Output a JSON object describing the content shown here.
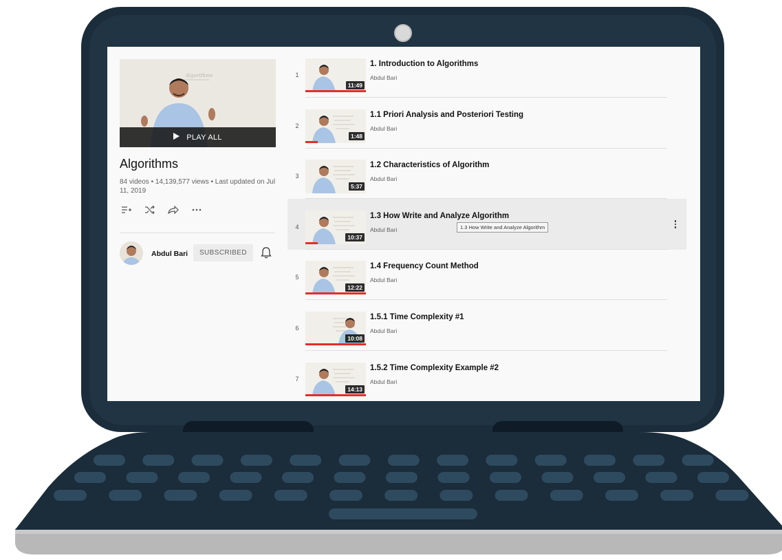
{
  "colors": {
    "laptop_body": "#1b2c3a",
    "key": "#2e4a5e",
    "base": "#bdbdbd",
    "accent": "#4fc3d6",
    "progress": "#e52d27",
    "hover_row": "#ebebeb"
  },
  "playlist": {
    "play_all_label": "PLAY ALL",
    "title": "Algorithms",
    "stats": "84 videos • 14,139,577 views • Last updated on Jul 11, 2019",
    "actions": [
      {
        "icon": "add-to-queue-icon",
        "glyph": "≡+"
      },
      {
        "icon": "shuffle-icon",
        "glyph": "⤮"
      },
      {
        "icon": "share-icon",
        "glyph": "⮫"
      },
      {
        "icon": "more-horizontal-icon",
        "glyph": "⋯"
      }
    ]
  },
  "channel": {
    "name": "Abdul Bari",
    "subscribe_label": "SUBSCRIBED"
  },
  "videos": [
    {
      "index": "1",
      "title": "1. Introduction to Algorithms",
      "channel": "Abdul Bari",
      "duration": "11:49",
      "progress": 1.0
    },
    {
      "index": "2",
      "title": "1.1 Priori Analysis and Posteriori Testing",
      "channel": "Abdul Bari",
      "duration": "1:48",
      "progress": 0.2
    },
    {
      "index": "3",
      "title": "1.2 Characteristics of Algorithm",
      "channel": "Abdul Bari",
      "duration": "5:37",
      "progress": 0.0
    },
    {
      "index": "4",
      "title": "1.3 How Write and Analyze Algorithm",
      "channel": "Abdul Bari",
      "duration": "10:37",
      "progress": 0.2
    },
    {
      "index": "5",
      "title": "1.4 Frequency Count Method",
      "channel": "Abdul Bari",
      "duration": "12:22",
      "progress": 1.0
    },
    {
      "index": "6",
      "title": "1.5.1 Time Complexity #1",
      "channel": "Abdul Bari",
      "duration": "10:08",
      "progress": 1.0
    },
    {
      "index": "7",
      "title": "1.5.2 Time Complexity Example #2",
      "channel": "Abdul Bari",
      "duration": "14:13",
      "progress": 1.0
    }
  ],
  "hovered_row": 3,
  "tooltip": "1.3 How Write and Analyze Algorithm"
}
